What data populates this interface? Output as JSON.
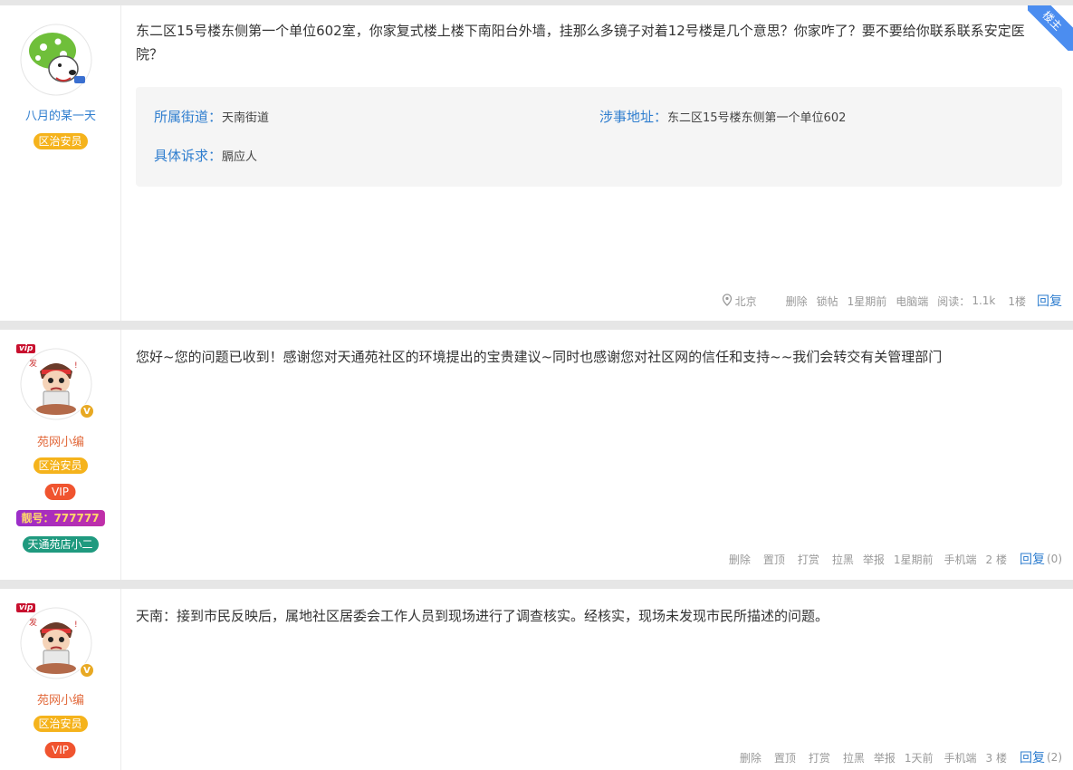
{
  "posts": [
    {
      "user": {
        "name": "八月的某一天",
        "role": "区治安员"
      },
      "corner_label": "楼主",
      "text": "东二区15号楼东侧第一个单位602室，你家复式楼上楼下南阳台外墙，挂那么多镜子对着12号楼是几个意思？你家咋了？要不要给你联系联系安定医院？",
      "info": {
        "street_label": "所属街道：",
        "street_value": "天南街道",
        "address_label": "涉事地址：",
        "address_value": "东二区15号楼东侧第一个单位602",
        "demand_label": "具体诉求：",
        "demand_value": "膈应人"
      },
      "footer": {
        "location": "北京",
        "delete": "删除",
        "lock": "锁帖",
        "time": "1星期前",
        "device": "电脑端",
        "read_label": "阅读：",
        "read_count": "1.1k",
        "floor": "1楼",
        "reply": "回复"
      }
    },
    {
      "user": {
        "name": "苑网小编",
        "role": "区治安员",
        "vip": "VIP",
        "number_badge": "靓号：777777",
        "shop_badge": "天通苑店小二",
        "vip_tag": "vip",
        "v_mark": "V"
      },
      "text": "您好~您的问题已收到！感谢您对天通苑社区的环境提出的宝贵建议~同时也感谢您对社区网的信任和支持~~我们会转交有关管理部门",
      "footer": {
        "delete": "删除",
        "pin": "置顶",
        "reward": "打赏",
        "block": "拉黑",
        "report": "举报",
        "time": "1星期前",
        "device": "手机端",
        "floor": "2 楼",
        "reply": "回复",
        "reply_count": "(0)"
      }
    },
    {
      "user": {
        "name": "苑网小编",
        "role": "区治安员",
        "vip": "VIP",
        "vip_tag": "vip",
        "v_mark": "V"
      },
      "text": "天南：接到市民反映后，属地社区居委会工作人员到现场进行了调查核实。经核实，现场未发现市民所描述的问题。",
      "footer": {
        "delete": "删除",
        "pin": "置顶",
        "reward": "打赏",
        "block": "拉黑",
        "report": "举报",
        "time": "1天前",
        "device": "手机端",
        "floor": "3 楼",
        "reply": "回复",
        "reply_count": "(2)"
      }
    }
  ],
  "colors": {
    "link": "#2f7ecf",
    "role_badge": "#f5b31c",
    "vip_badge": "#f0542f",
    "corner": "#4b8df0"
  }
}
